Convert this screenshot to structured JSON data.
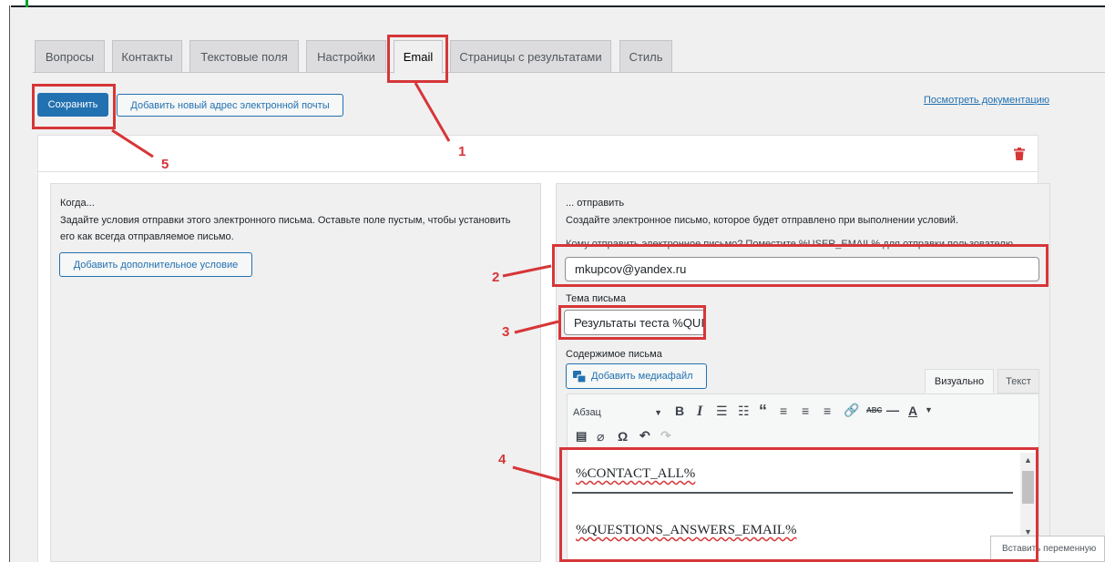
{
  "tabs": [
    {
      "label": "Вопросы"
    },
    {
      "label": "Контакты"
    },
    {
      "label": "Текстовые поля"
    },
    {
      "label": "Настройки"
    },
    {
      "label": "Email"
    },
    {
      "label": "Страницы с результатами"
    },
    {
      "label": "Стиль"
    }
  ],
  "active_tab": "Email",
  "toolbar": {
    "save_label": "Сохранить",
    "add_email_label": "Добавить новый адрес электронной почты",
    "docs_link": "Посмотреть документацию"
  },
  "when_panel": {
    "title": "Когда...",
    "description": "Задайте условия отправки этого электронного письма. Оставьте поле пустым, чтобы установить его как всегда отправляемое письмо.",
    "add_condition_label": "Добавить дополнительное условие"
  },
  "send_panel": {
    "title": "... отправить",
    "description": "Создайте электронное письмо, которое будет отправлено при выполнении условий.",
    "recipient_label": "Кому отправить электронное письмо? Поместите %USER_EMAIL% для отправки пользователю",
    "recipient_value": "mkupcov@yandex.ru",
    "subject_label": "Тема письма",
    "subject_value": "Результаты теста %QUIZ_NAME%",
    "content_label": "Содержимое письма",
    "add_media_label": "Добавить медиафайл",
    "tab_visual": "Визуально",
    "tab_text": "Текст",
    "format_select": "Абзац",
    "content_lines": [
      "%CONTACT_ALL%",
      "%QUESTIONS_ANSWERS_EMAIL%"
    ]
  },
  "tooltip": "Вставить переменную",
  "annotations": [
    "1",
    "2",
    "3",
    "4",
    "5"
  ],
  "colors": {
    "accent": "#2271b1",
    "annotation": "#d63638",
    "delete": "#d63638"
  },
  "icons": [
    "trash-icon",
    "media-icon",
    "bold-icon",
    "italic-icon",
    "bullet-list-icon",
    "numbered-list-icon",
    "blockquote-icon",
    "align-left-icon",
    "align-center-icon",
    "align-right-icon",
    "link-icon",
    "strikethrough-icon",
    "hr-icon",
    "text-color-icon",
    "paste-text-icon",
    "clear-format-icon",
    "omega-icon",
    "undo-icon",
    "redo-icon"
  ]
}
